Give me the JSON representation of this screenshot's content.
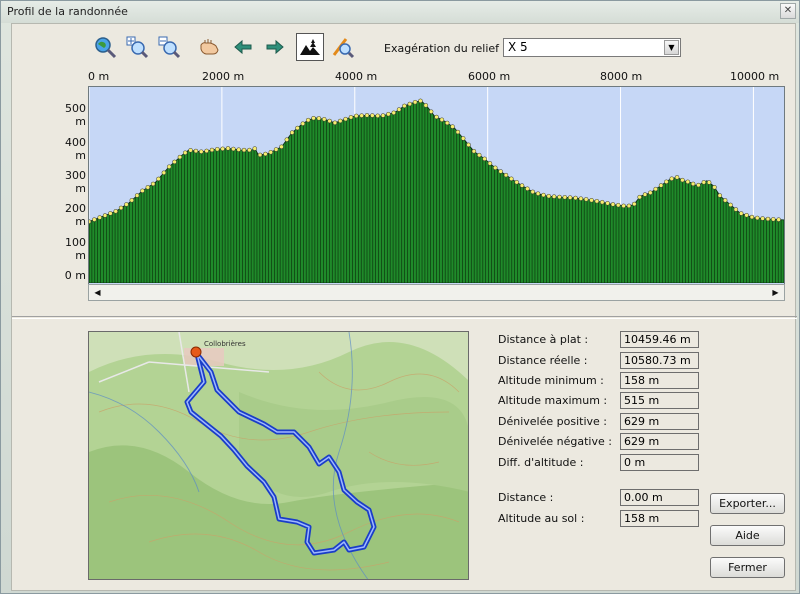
{
  "window": {
    "title": "Profil de la randonnée",
    "close_glyph": "✕"
  },
  "toolbar": {
    "icons": [
      "zoom-global-icon",
      "zoom-in-icon",
      "zoom-out-icon",
      "pan-hand-icon",
      "arrow-left-icon",
      "arrow-right-icon",
      "terrain-view-icon",
      "path-tool-icon"
    ],
    "exaggeration_label": "Exagération du relief :",
    "exaggeration_value": "X 5"
  },
  "chart_data": {
    "type": "area",
    "x_unit": "m",
    "y_unit": "m",
    "x_ticks": [
      "0 m",
      "2000 m",
      "4000 m",
      "6000 m",
      "8000 m",
      "10000 m"
    ],
    "y_ticks": [
      "500 m",
      "400 m",
      "300 m",
      "200 m",
      "100 m",
      "0 m"
    ],
    "xlim": [
      0,
      10460
    ],
    "ylim": [
      -20,
      555
    ],
    "colors": {
      "fill": "#1f8a2a",
      "background": "#c6d7f6",
      "point": "#f6ee70",
      "line": "#0a2a0a"
    },
    "points": [
      [
        0,
        160
      ],
      [
        200,
        175
      ],
      [
        400,
        190
      ],
      [
        600,
        215
      ],
      [
        800,
        250
      ],
      [
        1000,
        275
      ],
      [
        1200,
        320
      ],
      [
        1400,
        355
      ],
      [
        1500,
        370
      ],
      [
        1700,
        365
      ],
      [
        1900,
        372
      ],
      [
        2100,
        375
      ],
      [
        2300,
        370
      ],
      [
        2450,
        370
      ],
      [
        2500,
        375
      ],
      [
        2550,
        355
      ],
      [
        2700,
        360
      ],
      [
        2900,
        380
      ],
      [
        3050,
        420
      ],
      [
        3200,
        445
      ],
      [
        3300,
        458
      ],
      [
        3400,
        465
      ],
      [
        3550,
        460
      ],
      [
        3700,
        450
      ],
      [
        3850,
        460
      ],
      [
        4000,
        470
      ],
      [
        4200,
        472
      ],
      [
        4400,
        470
      ],
      [
        4600,
        480
      ],
      [
        4750,
        500
      ],
      [
        4900,
        510
      ],
      [
        5000,
        515
      ],
      [
        5100,
        495
      ],
      [
        5200,
        470
      ],
      [
        5350,
        455
      ],
      [
        5500,
        435
      ],
      [
        5650,
        400
      ],
      [
        5800,
        365
      ],
      [
        5950,
        345
      ],
      [
        6100,
        320
      ],
      [
        6250,
        300
      ],
      [
        6400,
        280
      ],
      [
        6550,
        262
      ],
      [
        6700,
        245
      ],
      [
        6900,
        235
      ],
      [
        7100,
        232
      ],
      [
        7300,
        230
      ],
      [
        7500,
        225
      ],
      [
        7700,
        218
      ],
      [
        7900,
        210
      ],
      [
        8100,
        205
      ],
      [
        8200,
        210
      ],
      [
        8300,
        235
      ],
      [
        8450,
        245
      ],
      [
        8600,
        265
      ],
      [
        8750,
        285
      ],
      [
        8850,
        290
      ],
      [
        8950,
        280
      ],
      [
        9050,
        275
      ],
      [
        9150,
        265
      ],
      [
        9300,
        280
      ],
      [
        9400,
        265
      ],
      [
        9500,
        235
      ],
      [
        9650,
        210
      ],
      [
        9800,
        185
      ],
      [
        10000,
        172
      ],
      [
        10200,
        168
      ],
      [
        10460,
        165
      ]
    ]
  },
  "map": {
    "place_label": "Collobrières"
  },
  "stats": [
    {
      "label": "Distance à plat :",
      "value": "10459.46 m"
    },
    {
      "label": "Distance réelle :",
      "value": "10580.73 m"
    },
    {
      "label": "Altitude minimum :",
      "value": "158 m"
    },
    {
      "label": "Altitude maximum :",
      "value": "515 m"
    },
    {
      "label": "Dénivelée positive :",
      "value": "629 m"
    },
    {
      "label": "Dénivelée négative :",
      "value": "629 m"
    },
    {
      "label": "Diff. d'altitude :",
      "value": "0 m"
    }
  ],
  "cursor": [
    {
      "label": "Distance :",
      "value": "0.00 m"
    },
    {
      "label": "Altitude au sol :",
      "value": "158 m"
    }
  ],
  "buttons": {
    "export": "Exporter...",
    "help": "Aide",
    "close": "Fermer"
  }
}
